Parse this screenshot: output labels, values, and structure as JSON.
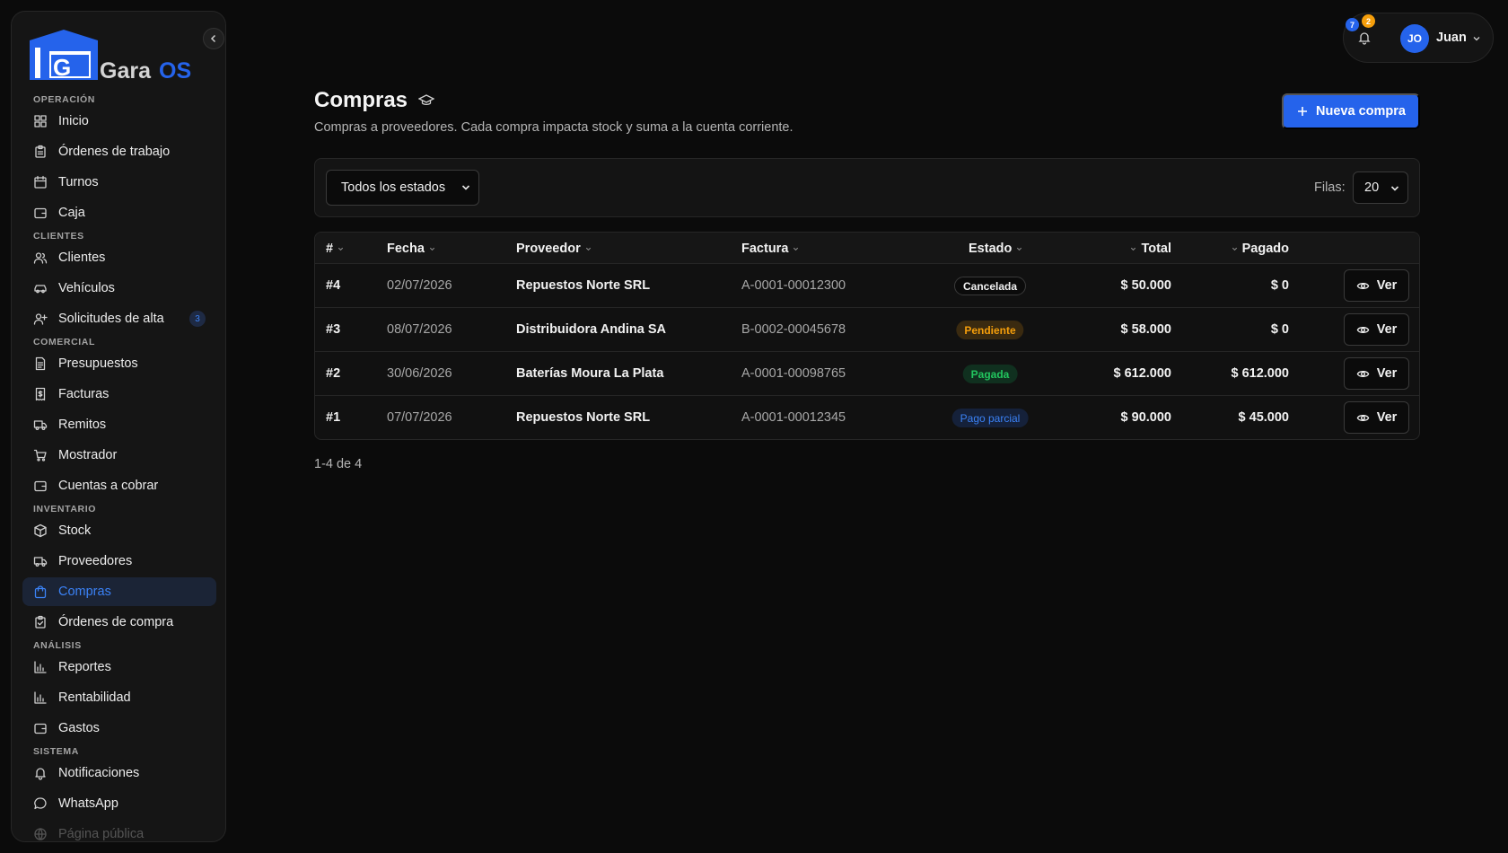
{
  "app": {
    "name": "GaraOS"
  },
  "sidebar": {
    "sections": [
      {
        "label": "OPERACIÓN",
        "items": [
          {
            "label": "Inicio",
            "icon": "grid-icon"
          },
          {
            "label": "Órdenes de trabajo",
            "icon": "clipboard-icon"
          },
          {
            "label": "Turnos",
            "icon": "calendar-icon"
          },
          {
            "label": "Caja",
            "icon": "wallet-icon"
          }
        ]
      },
      {
        "label": "CLIENTES",
        "items": [
          {
            "label": "Clientes",
            "icon": "users-icon"
          },
          {
            "label": "Vehículos",
            "icon": "car-icon"
          },
          {
            "label": "Solicitudes de alta",
            "icon": "user-plus-icon",
            "badge": "3"
          }
        ]
      },
      {
        "label": "COMERCIAL",
        "items": [
          {
            "label": "Presupuestos",
            "icon": "document-icon"
          },
          {
            "label": "Facturas",
            "icon": "receipt-icon"
          },
          {
            "label": "Remitos",
            "icon": "truck-icon"
          },
          {
            "label": "Mostrador",
            "icon": "cart-icon"
          },
          {
            "label": "Cuentas a cobrar",
            "icon": "wallet-icon"
          }
        ]
      },
      {
        "label": "INVENTARIO",
        "items": [
          {
            "label": "Stock",
            "icon": "box-icon"
          },
          {
            "label": "Proveedores",
            "icon": "truck-icon"
          },
          {
            "label": "Compras",
            "icon": "bag-icon",
            "active": true
          },
          {
            "label": "Órdenes de compra",
            "icon": "clipboard-check-icon"
          }
        ]
      },
      {
        "label": "ANÁLISIS",
        "items": [
          {
            "label": "Reportes",
            "icon": "bar-chart-icon"
          },
          {
            "label": "Rentabilidad",
            "icon": "bar-chart-icon"
          },
          {
            "label": "Gastos",
            "icon": "wallet-icon"
          }
        ]
      },
      {
        "label": "SISTEMA",
        "items": [
          {
            "label": "Notificaciones",
            "icon": "bell-icon"
          },
          {
            "label": "WhatsApp",
            "icon": "chat-icon"
          },
          {
            "label": "Página pública",
            "icon": "globe-icon",
            "faded": true
          }
        ]
      }
    ]
  },
  "header": {
    "notif_count_blue": "7",
    "notif_count_orange": "2",
    "avatar_initials": "JO",
    "user_name": "Juan"
  },
  "page": {
    "title": "Compras",
    "subtitle": "Compras a proveedores. Cada compra impacta stock y suma a la cuenta corriente.",
    "new_button": "Nueva compra"
  },
  "filters": {
    "status_value": "Todos los estados",
    "rows_label": "Filas:",
    "rows_value": "20"
  },
  "table": {
    "columns": {
      "id": "#",
      "fecha": "Fecha",
      "proveedor": "Proveedor",
      "factura": "Factura",
      "estado": "Estado",
      "total": "Total",
      "pagado": "Pagado"
    },
    "rows": [
      {
        "id": "#4",
        "fecha": "02/07/2026",
        "proveedor": "Repuestos Norte SRL",
        "factura": "A-0001-00012300",
        "estado": "Cancelada",
        "estado_kind": "cancel",
        "total": "$ 50.000",
        "pagado": "$ 0",
        "action": "Ver"
      },
      {
        "id": "#3",
        "fecha": "08/07/2026",
        "proveedor": "Distribuidora Andina SA",
        "factura": "B-0002-00045678",
        "estado": "Pendiente",
        "estado_kind": "pend",
        "total": "$ 58.000",
        "pagado": "$ 0",
        "action": "Ver"
      },
      {
        "id": "#2",
        "fecha": "30/06/2026",
        "proveedor": "Baterías Moura La Plata",
        "factura": "A-0001-00098765",
        "estado": "Pagada",
        "estado_kind": "paid",
        "total": "$ 612.000",
        "pagado": "$ 612.000",
        "action": "Ver"
      },
      {
        "id": "#1",
        "fecha": "07/07/2026",
        "proveedor": "Repuestos Norte SRL",
        "factura": "A-0001-00012345",
        "estado": "Pago parcial",
        "estado_kind": "partial",
        "total": "$ 90.000",
        "pagado": "$ 45.000",
        "action": "Ver"
      }
    ]
  },
  "pagination": {
    "summary": "1-4 de 4"
  },
  "colors": {
    "accent": "#2563eb",
    "background": "#0b0b0b",
    "surface": "#151515"
  }
}
